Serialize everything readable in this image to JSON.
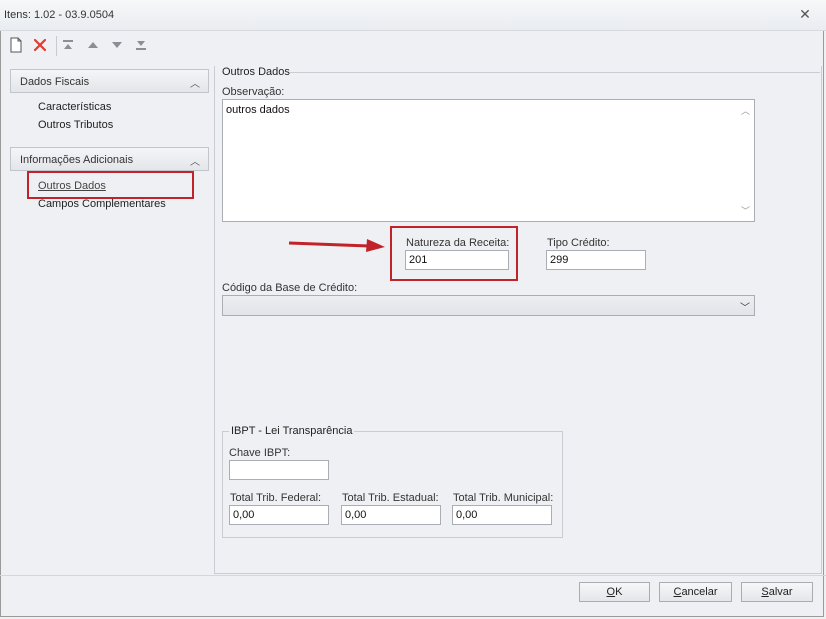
{
  "window": {
    "title": "Itens: 1.02 - 03.9.0504",
    "close_symbol": "✕"
  },
  "toolbar": {
    "icons": [
      "new-document-icon",
      "delete-icon",
      "move-first-icon",
      "move-up-icon",
      "move-down-icon",
      "move-last-icon"
    ]
  },
  "sidebar": {
    "groups": [
      {
        "label": "Dados Fiscais",
        "items": [
          "Características",
          "Outros Tributos"
        ]
      },
      {
        "label": "Informações Adicionais",
        "items": [
          "Outros Dados",
          "Campos Complementares"
        ]
      }
    ],
    "active_item": "Outros Dados"
  },
  "main": {
    "section_title": "Outros Dados",
    "observacao": {
      "label": "Observação:",
      "value": "outros dados"
    },
    "natureza_receita": {
      "label": "Natureza da Receita:",
      "value": "201"
    },
    "tipo_credito": {
      "label": "Tipo Crédito:",
      "value": "299"
    },
    "codigo_base_credito": {
      "label": "Código da Base de Crédito:",
      "value": ""
    },
    "ibpt": {
      "title": "IBPT - Lei Transparência",
      "chave_label": "Chave IBPT:",
      "chave_value": "",
      "federal_label": "Total Trib. Federal:",
      "federal_value": "0,00",
      "estadual_label": "Total Trib. Estadual:",
      "estadual_value": "0,00",
      "municipal_label": "Total Trib. Municipal:",
      "municipal_value": "0,00"
    }
  },
  "footer": {
    "ok_u": "O",
    "ok_rest": "K",
    "cancel_u": "C",
    "cancel_rest": "ancelar",
    "save_u": "S",
    "save_rest": "alvar"
  },
  "colors": {
    "highlight": "#c0232a",
    "delete_icon": "#e23a2e"
  }
}
